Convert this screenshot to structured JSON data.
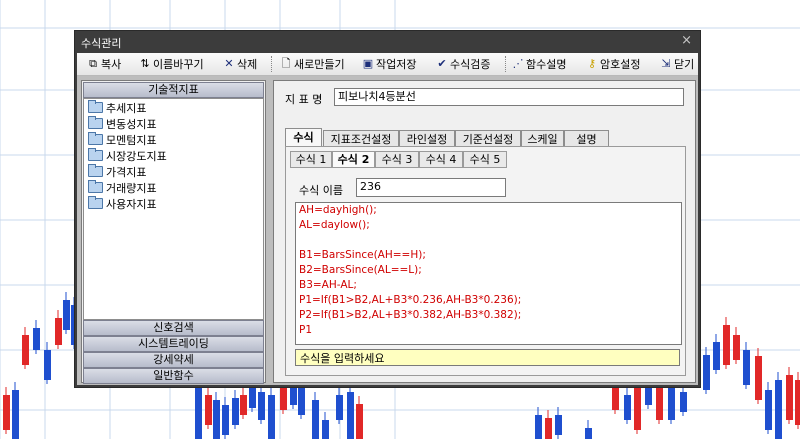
{
  "window": {
    "title": "수식관리",
    "close_glyph": "×"
  },
  "toolbar": {
    "copy": "복사",
    "rename": "이름바꾸기",
    "delete": "삭제",
    "new": "새로만들기",
    "save": "작업저장",
    "verify": "수식검증",
    "func_help": "함수설명",
    "password": "암호설정",
    "close": "닫기"
  },
  "left": {
    "header": "기술적지표",
    "items": [
      "추세지표",
      "변동성지표",
      "모멘텀지표",
      "시장강도지표",
      "가격지표",
      "거래량지표",
      "사용자지표"
    ],
    "bottom_sections": [
      "신호검색",
      "시스템트레이딩",
      "강세약세",
      "일반함수"
    ]
  },
  "right": {
    "indicator_label": "지 표 명",
    "indicator_value": "피보나치4등분선",
    "tabs": [
      "수식",
      "지표조건설정",
      "라인설정",
      "기준선설정",
      "스케일",
      "설명"
    ],
    "active_tab": "수식",
    "subtabs": [
      "수식 1",
      "수식 2",
      "수식 3",
      "수식 4",
      "수식 5"
    ],
    "active_subtab": "수식 2",
    "formula_name_label": "수식 이름",
    "formula_name_value": "236",
    "code_lines": [
      "AH=dayhigh();",
      "AL=daylow();",
      "",
      "B1=BarsSince(AH==H);",
      "B2=BarsSince(AL==L);",
      "B3=AH-AL;",
      "P1=If(B1>B2,AL+B3*0.236,AH-B3*0.236);",
      "P2=If(B1>B2,AL+B3*0.382,AH-B3*0.382);",
      "P1"
    ],
    "hint": "수식을 입력하세요"
  },
  "colors": {
    "dialog_frame": "#3c3c3c",
    "bull_candle": "#e12828",
    "bear_candle": "#1f4fcf",
    "code_text": "#d00000",
    "hint_bg": "#ffffc0"
  }
}
